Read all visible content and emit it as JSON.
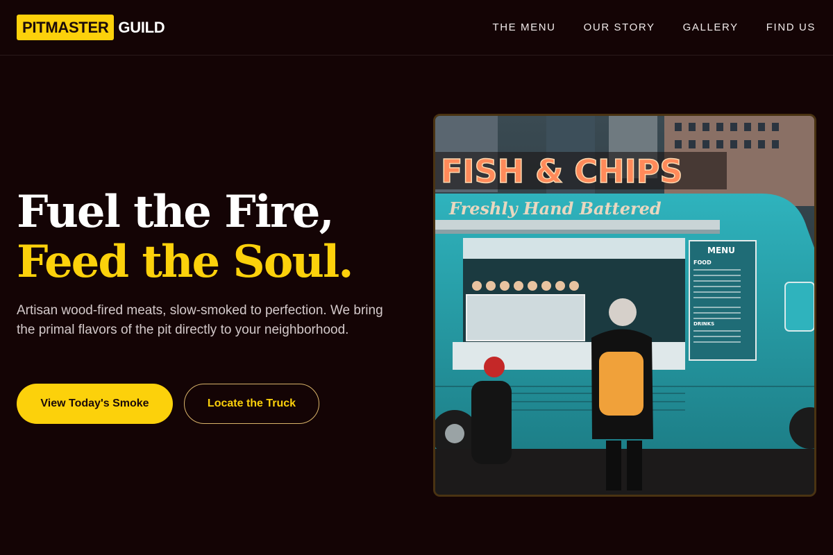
{
  "nav": {
    "logo_highlight": "PITMASTER",
    "logo_rest": "GUILD",
    "links": [
      {
        "label": "THE MENU"
      },
      {
        "label": "OUR STORY"
      },
      {
        "label": "GALLERY"
      },
      {
        "label": "FIND US"
      }
    ]
  },
  "hero": {
    "headline_line1": "Fuel the Fire,",
    "headline_line2": "Feed the Soul.",
    "tagline": "Artisan wood-fired meats, slow-smoked to perfection. We bring the primal flavors of the pit directly to your neighborhood.",
    "primary_button": "View Today's Smoke",
    "secondary_button": "Locate the Truck"
  },
  "image": {
    "sign_text": "FISH & CHIPS",
    "script_text": "Freshly Hand Battered",
    "menu_title": "MENU",
    "menu_food_heading": "FOOD",
    "menu_drinks_heading": "DRINKS",
    "side_sign": "FISH & CHIPS"
  },
  "colors": {
    "background": "#140405",
    "accent": "#fcd10b",
    "truck": "#2aa3ad"
  }
}
